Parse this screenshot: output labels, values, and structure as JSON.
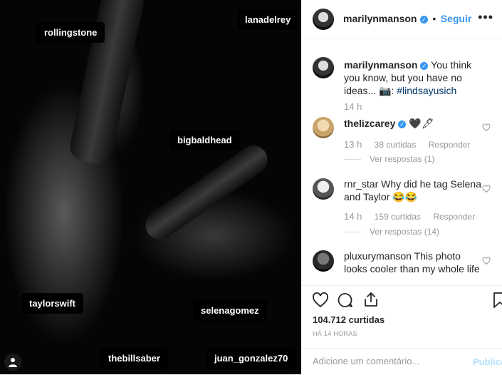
{
  "photo": {
    "tags": [
      "rollingstone",
      "lanadelrey",
      "bigbaldhead",
      "taylorswift",
      "selenagomez",
      "thebillsaber",
      "juan_gonzalez70"
    ]
  },
  "post": {
    "username": "marilynmanson",
    "separator": "•",
    "follow_label": "Seguir",
    "more_icon": "more-horizontal-icon",
    "caption": {
      "username": "marilynmanson",
      "text": "You think you know, but you have no ideas... 📷:",
      "hashtag": "#lindsayusich",
      "time": "14 h"
    },
    "comments": [
      {
        "username": "thelizcarey",
        "text": "🖤🖋",
        "time": "13 h",
        "likes": "38 curtidas",
        "reply": "Responder",
        "replies": "Ver respostas (1)"
      },
      {
        "username": "rnr_star",
        "text": "Why did he tag Selena and Taylor 😂😂",
        "time": "14 h",
        "likes": "159 curtidas",
        "reply": "Responder",
        "replies": "Ver respostas (14)"
      },
      {
        "username": "pluxurymanson",
        "text": "This photo looks cooler than my whole life"
      }
    ],
    "likes": "104.712 curtidas",
    "timestamp": "HÁ 14 HORAS",
    "add_comment_placeholder": "Adicione um comentário...",
    "publish_label": "Publicar"
  },
  "colors": {
    "link": "#3897f0",
    "verified": "#3897f0",
    "publish_disabled": "#b2dffc"
  }
}
